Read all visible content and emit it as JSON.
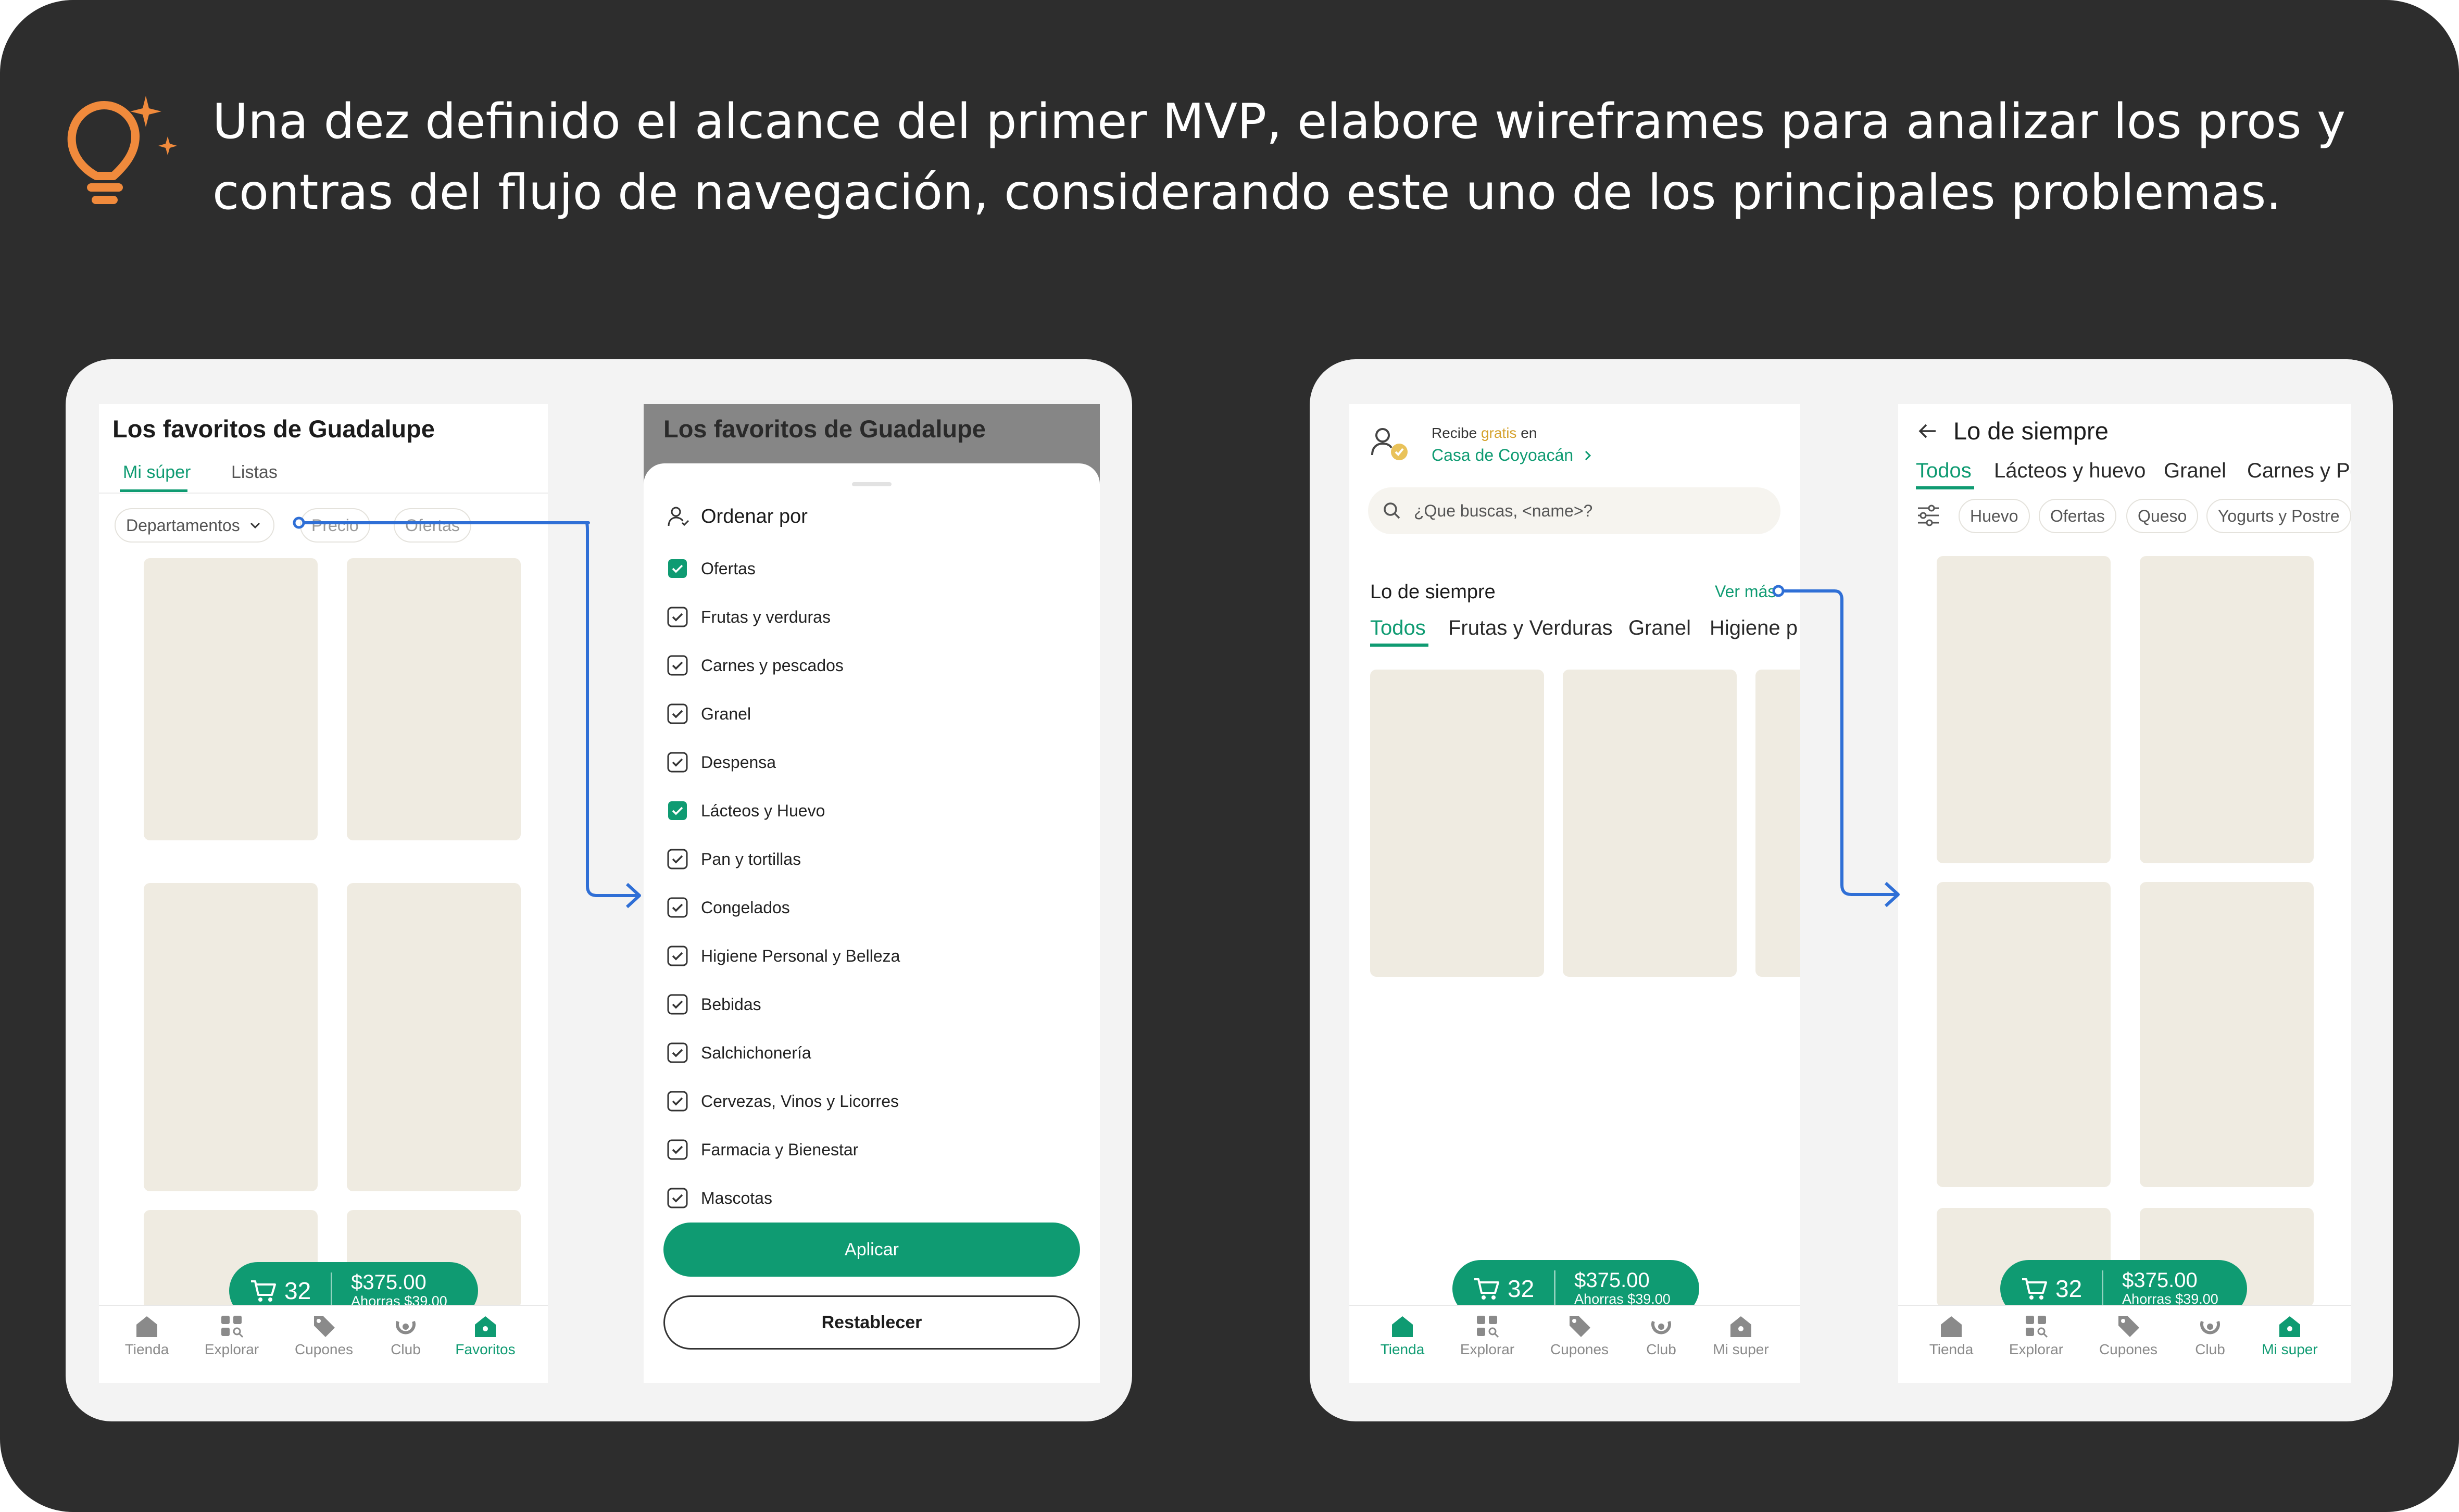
{
  "headline": {
    "line1": "Una dez definido el alcance del primer MVP, elabore wireframes para analizar los pros y",
    "line2": "contras del flujo de navegación, considerando este uno de los principales problemas."
  },
  "favoritos": {
    "title": "Los favoritos de Guadalupe",
    "tabs": [
      "Mi súper",
      "Listas"
    ],
    "filters": [
      "Departamentos",
      "Precio",
      "Ofertas"
    ]
  },
  "sheet": {
    "title": "Los favoritos de Guadalupe",
    "sort_label": "Ordenar por",
    "options": [
      {
        "label": "Ofertas",
        "checked": true
      },
      {
        "label": "Frutas y verduras",
        "checked": false
      },
      {
        "label": "Carnes y pescados",
        "checked": false
      },
      {
        "label": "Granel",
        "checked": false
      },
      {
        "label": "Despensa",
        "checked": false
      },
      {
        "label": "Lácteos y Huevo",
        "checked": true
      },
      {
        "label": "Pan y tortillas",
        "checked": false
      },
      {
        "label": "Congelados",
        "checked": false
      },
      {
        "label": "Higiene Personal y Belleza",
        "checked": false
      },
      {
        "label": "Bebidas",
        "checked": false
      },
      {
        "label": "Salchichonería",
        "checked": false
      },
      {
        "label": "Cervezas,  Vinos y Licorres",
        "checked": false
      },
      {
        "label": "Farmacia y Bienestar",
        "checked": false
      },
      {
        "label": "Mascotas",
        "checked": false
      }
    ],
    "apply_label": "Aplicar",
    "reset_label": "Restablecer"
  },
  "home": {
    "delivery_prefix": "Recibe",
    "delivery_free": "gratis",
    "delivery_suffix": "en",
    "address": "Casa de Coyoacán",
    "search_placeholder": "¿Que buscas, <name>?",
    "section_title": "Lo de siempre",
    "see_more": "Ver más",
    "tabs": [
      "Todos",
      "Frutas y Verduras",
      "Granel",
      "Higiene p"
    ]
  },
  "lds": {
    "title": "Lo de siempre",
    "tabs": [
      "Todos",
      "Lácteos y huevo",
      "Granel",
      "Carnes y Pe"
    ],
    "chips": [
      "Huevo",
      "Ofertas",
      "Queso",
      "Yogurts y Postre"
    ]
  },
  "cart": {
    "count": "32",
    "total": "$375.00",
    "savings": "Ahorras $39.00"
  },
  "nav_favoritos": [
    {
      "label": "Tienda",
      "icon": "home-icon"
    },
    {
      "label": "Explorar",
      "icon": "explore-icon"
    },
    {
      "label": "Cupones",
      "icon": "tag-icon"
    },
    {
      "label": "Club",
      "icon": "club-icon"
    },
    {
      "label": "Favoritos",
      "icon": "home-icon"
    }
  ],
  "nav_mi_super": [
    {
      "label": "Tienda",
      "icon": "home-icon"
    },
    {
      "label": "Explorar",
      "icon": "explore-icon"
    },
    {
      "label": "Cupones",
      "icon": "tag-icon"
    },
    {
      "label": "Club",
      "icon": "club-icon"
    },
    {
      "label": "Mi super",
      "icon": "home-icon"
    }
  ],
  "colors": {
    "background": "#2d2d2d",
    "accent": "#0f9b72",
    "placeholder": "#efebe1",
    "arrow": "#2f6fd6",
    "bulb": "#f08a3c"
  }
}
